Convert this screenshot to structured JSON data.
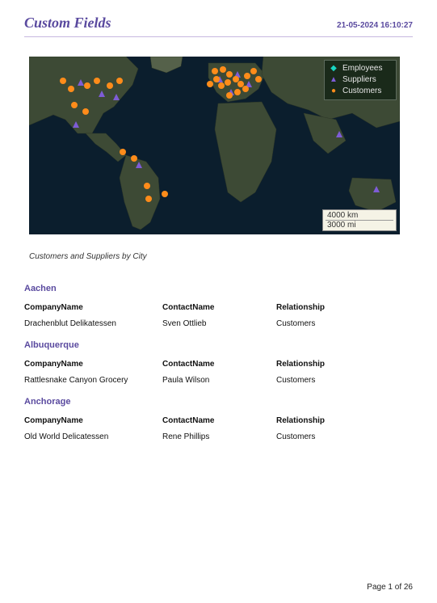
{
  "header": {
    "title": "Custom Fields",
    "timestamp": "21-05-2024 16:10:27"
  },
  "map": {
    "caption": "Customers and Suppliers by City",
    "legend": {
      "employees": "Employees",
      "suppliers": "Suppliers",
      "customers": "Customers"
    },
    "scale": {
      "km": "4000 km",
      "mi": "3000 mi"
    }
  },
  "columns": {
    "company": "CompanyName",
    "contact": "ContactName",
    "relationship": "Relationship"
  },
  "cities": [
    {
      "name": "Aachen",
      "rows": [
        {
          "company": "Drachenblut Delikatessen",
          "contact": "Sven Ottlieb",
          "relationship": "Customers"
        }
      ]
    },
    {
      "name": "Albuquerque",
      "rows": [
        {
          "company": "Rattlesnake Canyon Grocery",
          "contact": "Paula Wilson",
          "relationship": "Customers"
        }
      ]
    },
    {
      "name": "Anchorage",
      "rows": [
        {
          "company": "Old World Delicatessen",
          "contact": "Rene Phillips",
          "relationship": "Customers"
        }
      ]
    }
  ],
  "footer": {
    "pager": "Page 1 of 26"
  }
}
